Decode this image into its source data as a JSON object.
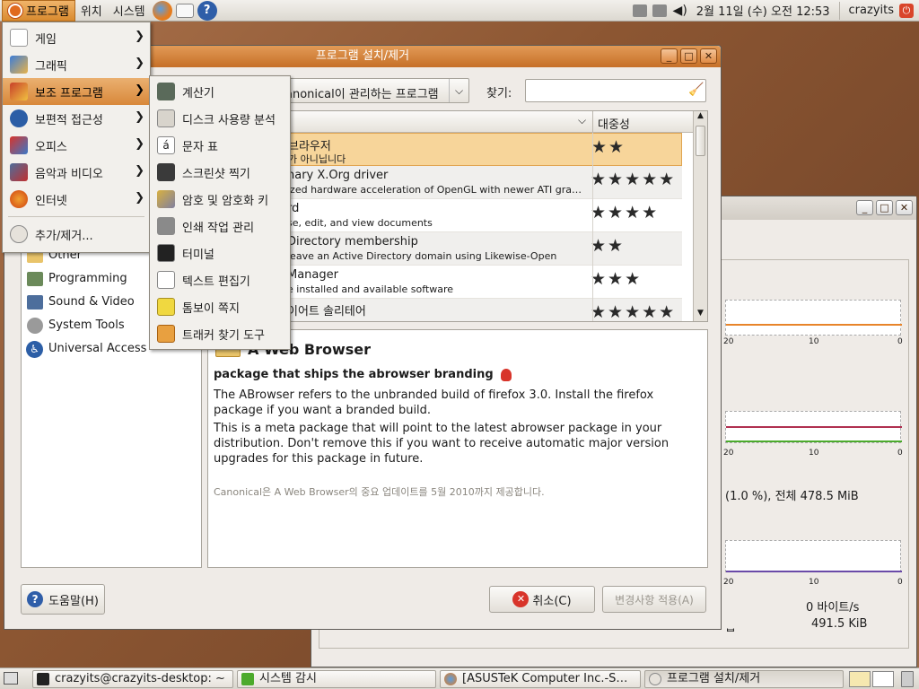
{
  "top_panel": {
    "applications": "프로그램",
    "places": "위치",
    "system": "시스템",
    "clock": "2월 11일 (수) 오전 12:53",
    "user": "crazyits"
  },
  "apps_menu": {
    "items": [
      {
        "label": "게임",
        "icon": "games-icon"
      },
      {
        "label": "그래픽",
        "icon": "graphics-icon"
      },
      {
        "label": "보조 프로그램",
        "icon": "accessories-icon"
      },
      {
        "label": "보편적 접근성",
        "icon": "accessibility-icon"
      },
      {
        "label": "오피스",
        "icon": "office-icon"
      },
      {
        "label": "음악과 비디오",
        "icon": "sound-video-icon"
      },
      {
        "label": "인터넷",
        "icon": "internet-icon"
      }
    ],
    "add_remove": "추가/제거..."
  },
  "accessories_menu": {
    "items": [
      {
        "label": "계산기",
        "icon": "calculator-icon"
      },
      {
        "label": "디스크 사용량 분석",
        "icon": "disk-usage-icon"
      },
      {
        "label": "문자 표",
        "icon": "character-map-icon"
      },
      {
        "label": "스크린샷 찍기",
        "icon": "camera-icon"
      },
      {
        "label": "암호 및 암호화 키",
        "icon": "keys-icon"
      },
      {
        "label": "인쇄 작업 관리",
        "icon": "printer-icon"
      },
      {
        "label": "터미널",
        "icon": "terminal-icon"
      },
      {
        "label": "텍스트 편집기",
        "icon": "text-editor-icon"
      },
      {
        "label": "톰보이 쪽지",
        "icon": "tomboy-notes-icon"
      },
      {
        "label": "트래커 찾기 도구",
        "icon": "tracker-search-icon"
      }
    ]
  },
  "add_remove_window": {
    "title": "프로그램 설치/제거",
    "show_select": "anonical이 관리하는 프로그램",
    "search_label": "찾기:",
    "search_value": "",
    "column_popularity": "대중성",
    "categories": [
      "Other",
      "Programming",
      "Sound & Video",
      "System Tools",
      "Universal Access"
    ],
    "rows": [
      {
        "name": "브라우저",
        "desc": "가 아니닙니다",
        "stars": "★★"
      },
      {
        "name": "nary X.Org driver",
        "desc": "ized hardware acceleration of OpenGL with newer ATI gra…",
        "stars": "★★★★★"
      },
      {
        "name": "rd",
        "desc": "se, edit, and view documents",
        "stars": "★★★★"
      },
      {
        "name": "Directory membership",
        "desc": "leave an Active Directory domain using Likewise-Open",
        "stars": "★★"
      },
      {
        "name": "Manager",
        "desc": "e installed and available software",
        "stars": "★★★"
      },
      {
        "name": "이어트 솔리테어",
        "desc": "",
        "stars": "★★★★★"
      }
    ],
    "detail_title": "A Web Browser",
    "detail_pkg": "package that ships the abrowser branding",
    "detail_p1": "The ABrowser refers to the unbranded build of firefox 3.0. Install the firefox package if you want a branded build.",
    "detail_p2": "This is a meta package that will point to the latest abrowser package in your distribution. Don't remove this if you want to receive automatic major version upgrades for this package in future.",
    "detail_note": "Canonical은 A Web Browser의 중요 업데이트를 5월 2010까지 제공합니다.",
    "help_btn": "도움말(H)",
    "cancel_btn": "취소(C)",
    "apply_btn": "변경사항 적용(A)"
  },
  "monitor_window": {
    "axis_labels": [
      "20",
      "10",
      "0"
    ],
    "memory_text": "(1.0 %), 전체 478.5 MiB",
    "net_rate": "0 바이트/s",
    "net_total": "491.5 KiB",
    "net_label": "ᆸ"
  },
  "taskbar": {
    "tasks": [
      {
        "label": "crazyits@crazyits-desktop: ~"
      },
      {
        "label": "시스템 감시"
      },
      {
        "label": "[ASUSTeK Computer Inc.-S…"
      },
      {
        "label": "프로그램 설치/제거"
      }
    ]
  },
  "colors": {
    "accent": "#d9883a",
    "titlebar": "#c67028",
    "highlight_row": "#f7d59a"
  }
}
